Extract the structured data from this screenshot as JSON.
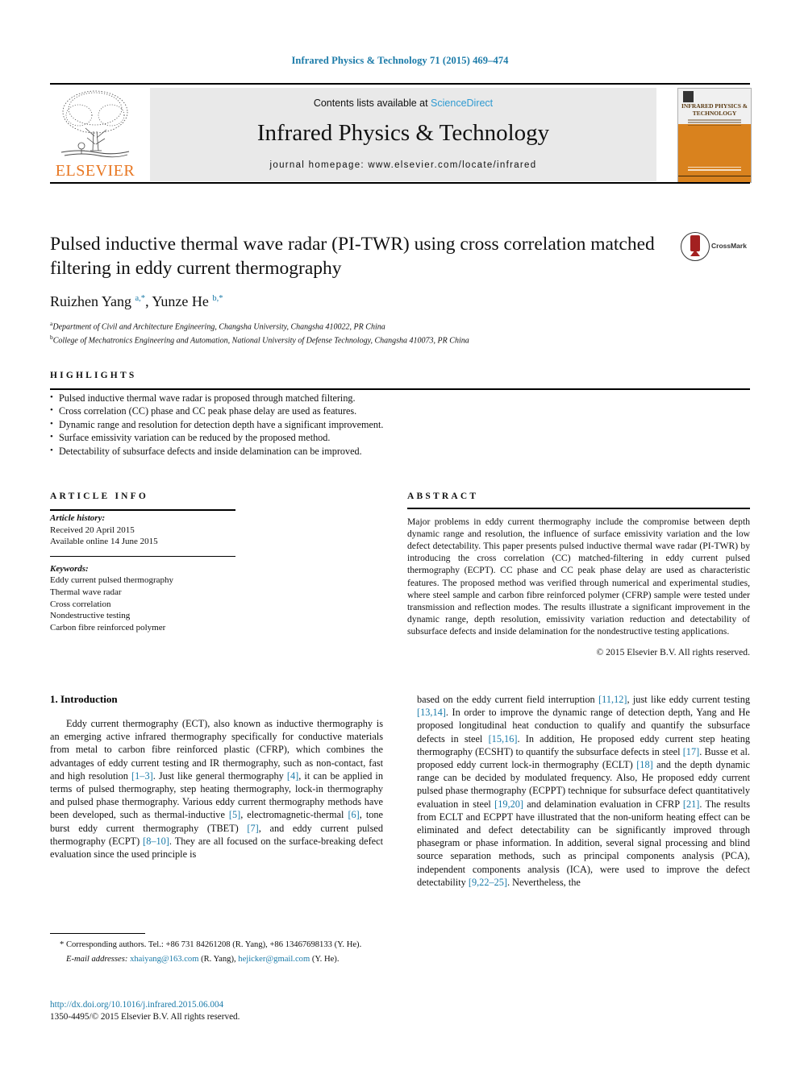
{
  "running_head": "Infrared Physics & Technology 71 (2015) 469–474",
  "masthead": {
    "publisher": "ELSEVIER",
    "contents_prefix": "Contents lists available at ",
    "contents_link": "ScienceDirect",
    "journal_title": "Infrared Physics & Technology",
    "homepage": "journal homepage: www.elsevier.com/locate/infrared",
    "cover_title": "INFRARED PHYSICS & TECHNOLOGY"
  },
  "article": {
    "title": "Pulsed inductive thermal wave radar (PI-TWR) using cross correlation matched filtering in eddy current thermography",
    "crossmark_label": "CrossMark",
    "authors_html": "Ruizhen Yang <sup>a,*</sup>, Yunze He <sup>b,*</sup>",
    "affiliation_a": "Department of Civil and Architecture Engineering, Changsha University, Changsha 410022, PR China",
    "affiliation_b": "College of Mechatronics Engineering and Automation, National University of Defense Technology, Changsha 410073, PR China"
  },
  "highlights": {
    "heading": "HIGHLIGHTS",
    "items": [
      "Pulsed inductive thermal wave radar is proposed through matched filtering.",
      "Cross correlation (CC) phase and CC peak phase delay are used as features.",
      "Dynamic range and resolution for detection depth have a significant improvement.",
      "Surface emissivity variation can be reduced by the proposed method.",
      "Detectability of subsurface defects and inside delamination can be improved."
    ]
  },
  "article_info": {
    "heading": "ARTICLE INFO",
    "history_label": "Article history:",
    "history_lines": [
      "Received 20 April 2015",
      "Available online 14 June 2015"
    ],
    "keywords_label": "Keywords:",
    "keywords": [
      "Eddy current pulsed thermography",
      "Thermal wave radar",
      "Cross correlation",
      "Nondestructive testing",
      "Carbon fibre reinforced polymer"
    ]
  },
  "abstract": {
    "heading": "ABSTRACT",
    "text": "Major problems in eddy current thermography include the compromise between depth dynamic range and resolution, the influence of surface emissivity variation and the low defect detectability. This paper presents pulsed inductive thermal wave radar (PI-TWR) by introducing the cross correlation (CC) matched-filtering in eddy current pulsed thermography (ECPT). CC phase and CC peak phase delay are used as characteristic features. The proposed method was verified through numerical and experimental studies, where steel sample and carbon fibre reinforced polymer (CFRP) sample were tested under transmission and reflection modes. The results illustrate a significant improvement in the dynamic range, depth resolution, emissivity variation reduction and detectability of subsurface defects and inside delamination for the nondestructive testing applications.",
    "copyright": "© 2015 Elsevier B.V. All rights reserved."
  },
  "introduction": {
    "heading": "1. Introduction",
    "left_html": "Eddy current thermography (ECT), also known as inductive thermography is an emerging active infrared thermography specifically for conductive materials from metal to carbon fibre reinforced plastic (CFRP), which combines the advantages of eddy current testing and IR thermography, such as non-contact, fast and high resolution <span class=\"ref\">[1–3]</span>. Just like general thermography <span class=\"ref\">[4]</span>, it can be applied in terms of pulsed thermography, step heating thermography, lock-in thermography and pulsed phase thermography. Various eddy current thermography methods have been developed, such as thermal-inductive <span class=\"ref\">[5]</span>, electromagnetic-thermal <span class=\"ref\">[6]</span>, tone burst eddy current thermography (TBET) <span class=\"ref\">[7]</span>, and eddy current pulsed thermography (ECPT) <span class=\"ref\">[8–10]</span>. They are all focused on the surface-breaking defect evaluation since the used principle is",
    "right_html": "based on the eddy current field interruption <span class=\"ref\">[11,12]</span>, just like eddy current testing <span class=\"ref\">[13,14]</span>. In order to improve the dynamic range of detection depth, Yang and He proposed longitudinal heat conduction to qualify and quantify the subsurface defects in steel <span class=\"ref\">[15,16]</span>. In addition, He proposed eddy current step heating thermography (ECSHT) to quantify the subsurface defects in steel <span class=\"ref\">[17]</span>. Busse et al. proposed eddy current lock-in thermography (ECLT) <span class=\"ref\">[18]</span> and the depth dynamic range can be decided by modulated frequency. Also, He proposed eddy current pulsed phase thermography (ECPPT) technique for subsurface defect quantitatively evaluation in steel <span class=\"ref\">[19,20]</span> and delamination evaluation in CFRP <span class=\"ref\">[21]</span>. The results from ECLT and ECPPT have illustrated that the non-uniform heating effect can be eliminated and defect detectability can be significantly improved through phasegram or phase information. In addition, several signal processing and blind source separation methods, such as principal components analysis (PCA), independent components analysis (ICA), were used to improve the defect detectability <span class=\"ref\">[9,22–25]</span>. Nevertheless, the"
  },
  "footnotes": {
    "corresponding_html": "* Corresponding authors. Tel.: +86 731 84261208 (R. Yang), +86 13467698133 (Y. He).",
    "email_html": "<span class=\"em\">E-mail addresses:</span> <span class=\"link\">xhaiyang@163.com</span> (R. Yang), <span class=\"link\">hejicker@gmail.com</span> (Y. He)."
  },
  "footer": {
    "doi": "http://dx.doi.org/10.1016/j.infrared.2015.06.004",
    "issn": "1350-4495/© 2015 Elsevier B.V. All rights reserved."
  },
  "colors": {
    "link_blue": "#1a7aa8",
    "sciencedirect_blue": "#2f9ad1",
    "elsevier_orange": "#e87722",
    "cover_orange": "#d9821e",
    "banner_grey": "#e9e9e9"
  }
}
